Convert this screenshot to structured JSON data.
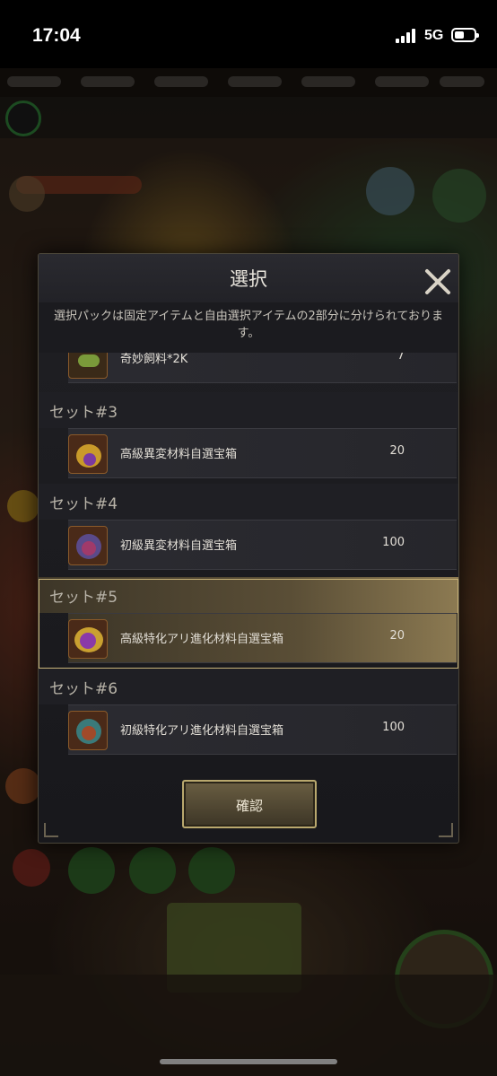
{
  "status_bar": {
    "time": "17:04",
    "network": "5G"
  },
  "modal": {
    "title": "選択",
    "description": "選択パックは固定アイテムと自由選択アイテムの2部分に分けられております。",
    "partial_item": {
      "name": "奇妙飼料*2K",
      "qty": "7"
    },
    "sets": [
      {
        "label": "セット#3",
        "item": "高級異変材料自選宝箱",
        "qty": "20",
        "selected": false
      },
      {
        "label": "セット#4",
        "item": "初級異変材料自選宝箱",
        "qty": "100",
        "selected": false
      },
      {
        "label": "セット#5",
        "item": "高級特化アリ進化材料自選宝箱",
        "qty": "20",
        "selected": true
      },
      {
        "label": "セット#6",
        "item": "初級特化アリ進化材料自選宝箱",
        "qty": "100",
        "selected": false
      }
    ],
    "confirm_label": "確認"
  },
  "colors": {
    "accent_gold": "#c9b47a",
    "panel": "#1f1f23"
  }
}
